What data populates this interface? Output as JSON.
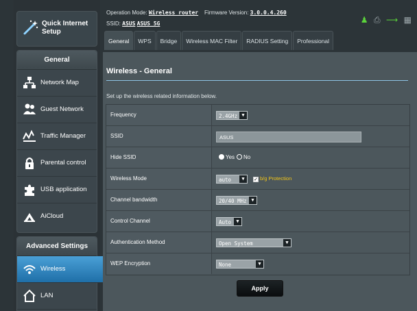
{
  "colors": {
    "accent": "#2a84c6",
    "panel": "#4c575c",
    "sidebar": "#3c464c",
    "warning": "#f0c419"
  },
  "header": {
    "op_mode_label": "Operation Mode:",
    "op_mode_value": "Wireless router",
    "firmware_label": "Firmware Version:",
    "firmware_value": "3.0.0.4.260",
    "ssid_label": "SSID:",
    "ssid_1": "ASUS",
    "ssid_2": "ASUS_5G",
    "status_icons": [
      "user-icon",
      "printer-icon",
      "usb-icon",
      "network-icon"
    ]
  },
  "sidebar": {
    "quick_setup": "Quick Internet Setup",
    "general_title": "General",
    "general_items": [
      {
        "label": "Network Map",
        "icon": "network-map-icon"
      },
      {
        "label": "Guest Network",
        "icon": "guest-network-icon"
      },
      {
        "label": "Traffic Manager",
        "icon": "traffic-manager-icon"
      },
      {
        "label": "Parental control",
        "icon": "lock-icon"
      },
      {
        "label": "USB application",
        "icon": "puzzle-icon"
      },
      {
        "label": "AiCloud",
        "icon": "cloud-icon"
      }
    ],
    "advanced_title": "Advanced Settings",
    "advanced_items": [
      {
        "label": "Wireless",
        "icon": "wifi-icon",
        "active": true
      },
      {
        "label": "LAN",
        "icon": "home-icon",
        "active": false
      }
    ]
  },
  "tabs": [
    {
      "label": "General",
      "active": true
    },
    {
      "label": "WPS",
      "active": false
    },
    {
      "label": "Bridge",
      "active": false
    },
    {
      "label": "Wireless MAC Filter",
      "active": false
    },
    {
      "label": "RADIUS Setting",
      "active": false
    },
    {
      "label": "Professional",
      "active": false
    }
  ],
  "panel": {
    "title": "Wireless - General",
    "description": "Set up the wireless related information below."
  },
  "form": {
    "frequency": {
      "label": "Frequency",
      "value": "2.4GHz"
    },
    "ssid": {
      "label": "SSID",
      "value": "ASUS"
    },
    "hide_ssid": {
      "label": "Hide SSID",
      "yes": "Yes",
      "no": "No",
      "selected": "Yes"
    },
    "wireless_mode": {
      "label": "Wireless Mode",
      "value": "auto",
      "protection_label": "b/g Protection",
      "protection_checked": true
    },
    "channel_bandwidth": {
      "label": "Channel bandwidth",
      "value": "20/40 MHz"
    },
    "control_channel": {
      "label": "Control Channel",
      "value": "Auto"
    },
    "auth_method": {
      "label": "Authentication Method",
      "value": "Open System"
    },
    "wep_encryption": {
      "label": "WEP Encryption",
      "value": "None"
    }
  },
  "apply_label": "Apply"
}
